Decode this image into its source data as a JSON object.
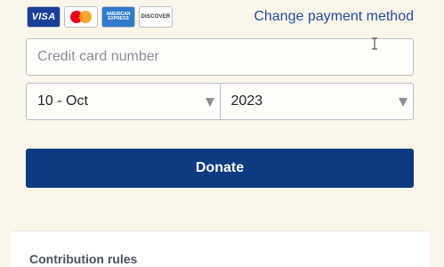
{
  "payment": {
    "cards": [
      {
        "name": "visa",
        "label": "VISA"
      },
      {
        "name": "mastercard",
        "label": ""
      },
      {
        "name": "amex",
        "label": "AMERICAN EXPRESS"
      },
      {
        "name": "discover",
        "label": "DISCOVER"
      }
    ],
    "change_link": "Change payment method"
  },
  "card_number": {
    "placeholder": "Credit card number",
    "value": ""
  },
  "expiry": {
    "month": "10 - Oct",
    "year": "2023"
  },
  "donate_label": "Donate",
  "contribution_rules": {
    "title": "Contribution rules"
  },
  "colors": {
    "primary": "#0e3a82",
    "link": "#1f4fa0",
    "background": "#fbf6ea"
  }
}
